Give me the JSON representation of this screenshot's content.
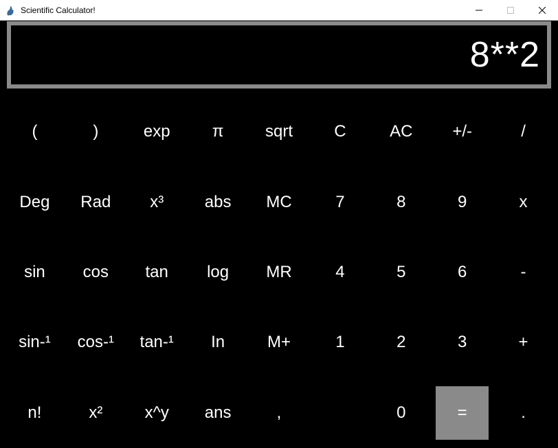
{
  "window": {
    "title": "Scientific Calculator!"
  },
  "display": {
    "value": "8**2"
  },
  "buttons": {
    "row1": [
      "(",
      ")",
      "exp",
      "π",
      "sqrt",
      "C",
      "AC",
      "+/-",
      "/"
    ],
    "row2": [
      "Deg",
      "Rad",
      "x³",
      "abs",
      "MC",
      "7",
      "8",
      "9",
      "x"
    ],
    "row3": [
      "sin",
      "cos",
      "tan",
      "log",
      "MR",
      "4",
      "5",
      "6",
      "-"
    ],
    "row4": [
      "sin-¹",
      "cos-¹",
      "tan-¹",
      "In",
      "M+",
      "1",
      "2",
      "3",
      "+"
    ],
    "row5": [
      "n!",
      "x²",
      "x^y",
      "ans",
      ",",
      "",
      "0",
      "",
      "."
    ]
  },
  "equals_label": "="
}
